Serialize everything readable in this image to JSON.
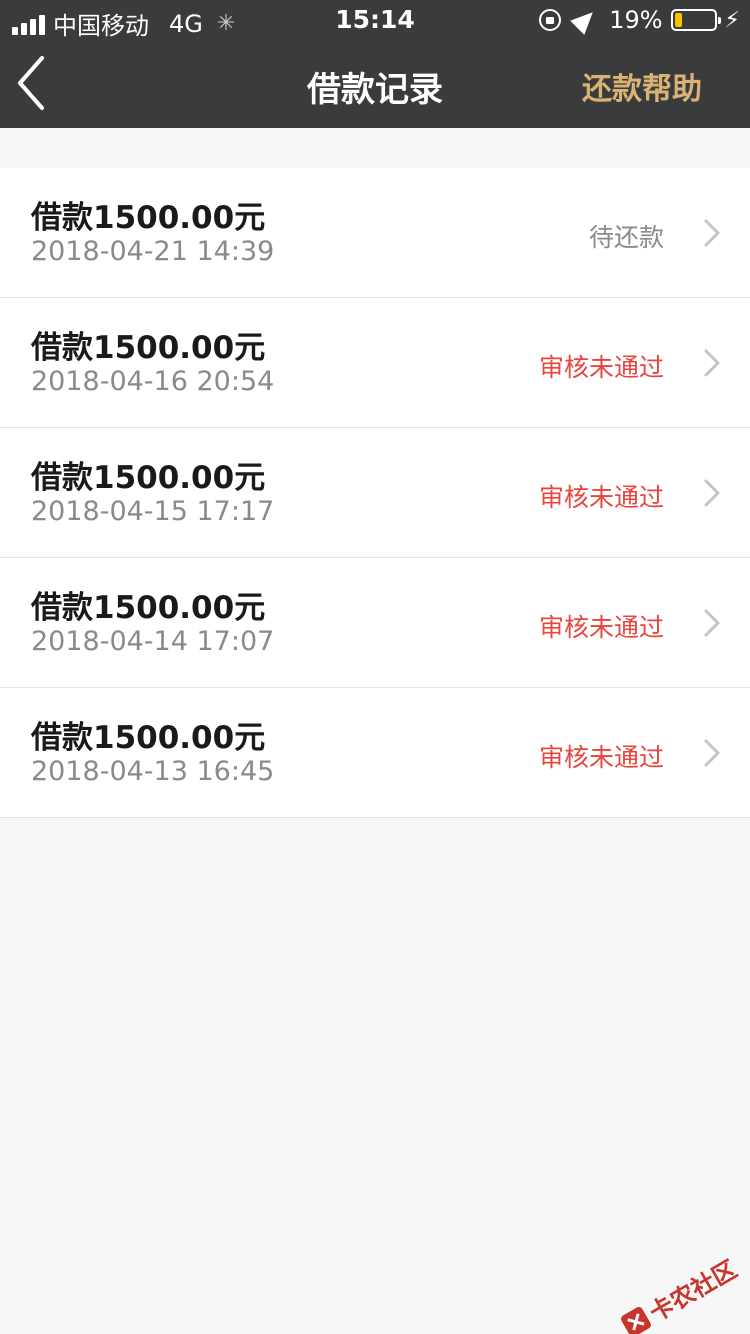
{
  "status_bar": {
    "carrier": "中国移动",
    "network": "4G",
    "time": "15:14",
    "battery_percent": "19%",
    "battery_level": 0.19
  },
  "nav": {
    "title": "借款记录",
    "help_label": "还款帮助"
  },
  "colors": {
    "nav_bg": "#3a3b3d",
    "accent_gold": "#d9b274",
    "status_rejected": "#e9453f",
    "status_pending": "#8a8a8a"
  },
  "records": [
    {
      "amount": "借款1500.00元",
      "date": "2018-04-21 14:39",
      "status": "待还款",
      "status_type": "pending"
    },
    {
      "amount": "借款1500.00元",
      "date": "2018-04-16 20:54",
      "status": "审核未通过",
      "status_type": "rejected"
    },
    {
      "amount": "借款1500.00元",
      "date": "2018-04-15 17:17",
      "status": "审核未通过",
      "status_type": "rejected"
    },
    {
      "amount": "借款1500.00元",
      "date": "2018-04-14 17:07",
      "status": "审核未通过",
      "status_type": "rejected"
    },
    {
      "amount": "借款1500.00元",
      "date": "2018-04-13 16:45",
      "status": "审核未通过",
      "status_type": "rejected"
    }
  ],
  "watermark": {
    "text": "卡农社区"
  }
}
